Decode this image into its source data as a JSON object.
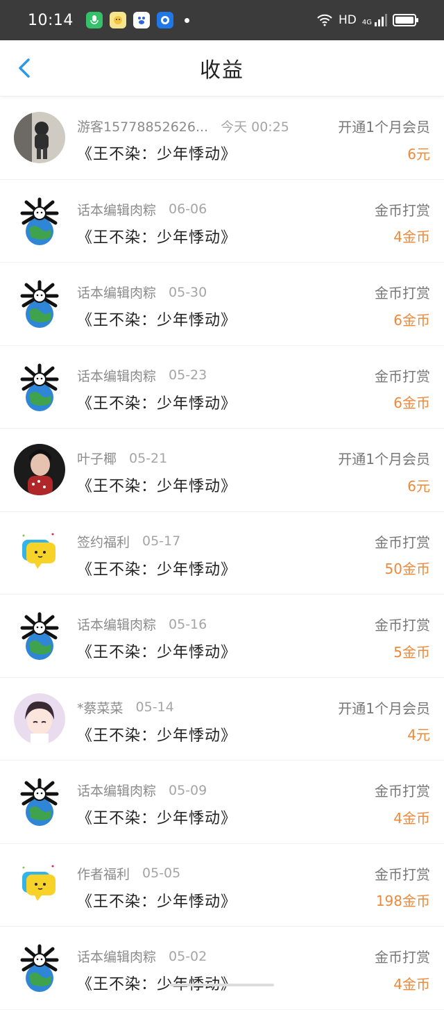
{
  "status_bar": {
    "time": "10:14",
    "network": "HD",
    "signal": "4G"
  },
  "header": {
    "title": "收益"
  },
  "records": [
    {
      "user": "游客15778852626...",
      "date": "今天 00:25",
      "type": "开通1个月会员",
      "book": "《王不染：少年悸动》",
      "amount": "6元",
      "avatar": "photo-avatar-icon"
    },
    {
      "user": "话本编辑肉粽",
      "date": "06-06",
      "type": "金币打赏",
      "book": "《王不染：少年悸动》",
      "amount": "4金币",
      "avatar": "earth-cartoon-avatar-icon"
    },
    {
      "user": "话本编辑肉粽",
      "date": "05-30",
      "type": "金币打赏",
      "book": "《王不染：少年悸动》",
      "amount": "6金币",
      "avatar": "earth-cartoon-avatar-icon"
    },
    {
      "user": "话本编辑肉粽",
      "date": "05-23",
      "type": "金币打赏",
      "book": "《王不染：少年悸动》",
      "amount": "6金币",
      "avatar": "earth-cartoon-avatar-icon"
    },
    {
      "user": "叶子椰",
      "date": "05-21",
      "type": "开通1个月会员",
      "book": "《王不染：少年悸动》",
      "amount": "6元",
      "avatar": "portrait-avatar-icon"
    },
    {
      "user": "签约福利",
      "date": "05-17",
      "type": "金币打赏",
      "book": "《王不染：少年悸动》",
      "amount": "50金币",
      "avatar": "chat-bubble-avatar-icon"
    },
    {
      "user": "话本编辑肉粽",
      "date": "05-16",
      "type": "金币打赏",
      "book": "《王不染：少年悸动》",
      "amount": "5金币",
      "avatar": "earth-cartoon-avatar-icon"
    },
    {
      "user": "*蔡菜菜",
      "date": "05-14",
      "type": "开通1个月会员",
      "book": "《王不染：少年悸动》",
      "amount": "4元",
      "avatar": "anime-avatar-icon"
    },
    {
      "user": "话本编辑肉粽",
      "date": "05-09",
      "type": "金币打赏",
      "book": "《王不染：少年悸动》",
      "amount": "4金币",
      "avatar": "earth-cartoon-avatar-icon"
    },
    {
      "user": "作者福利",
      "date": "05-05",
      "type": "金币打赏",
      "book": "《王不染：少年悸动》",
      "amount": "198金币",
      "avatar": "chat-bubble-avatar-icon"
    },
    {
      "user": "话本编辑肉粽",
      "date": "05-02",
      "type": "金币打赏",
      "book": "《王不染：少年悸动》",
      "amount": "4金币",
      "avatar": "earth-cartoon-avatar-icon"
    }
  ],
  "colors": {
    "accent": "#2a9ae8",
    "amount": "#f0883a",
    "status_bar": "#3b3b3b"
  }
}
